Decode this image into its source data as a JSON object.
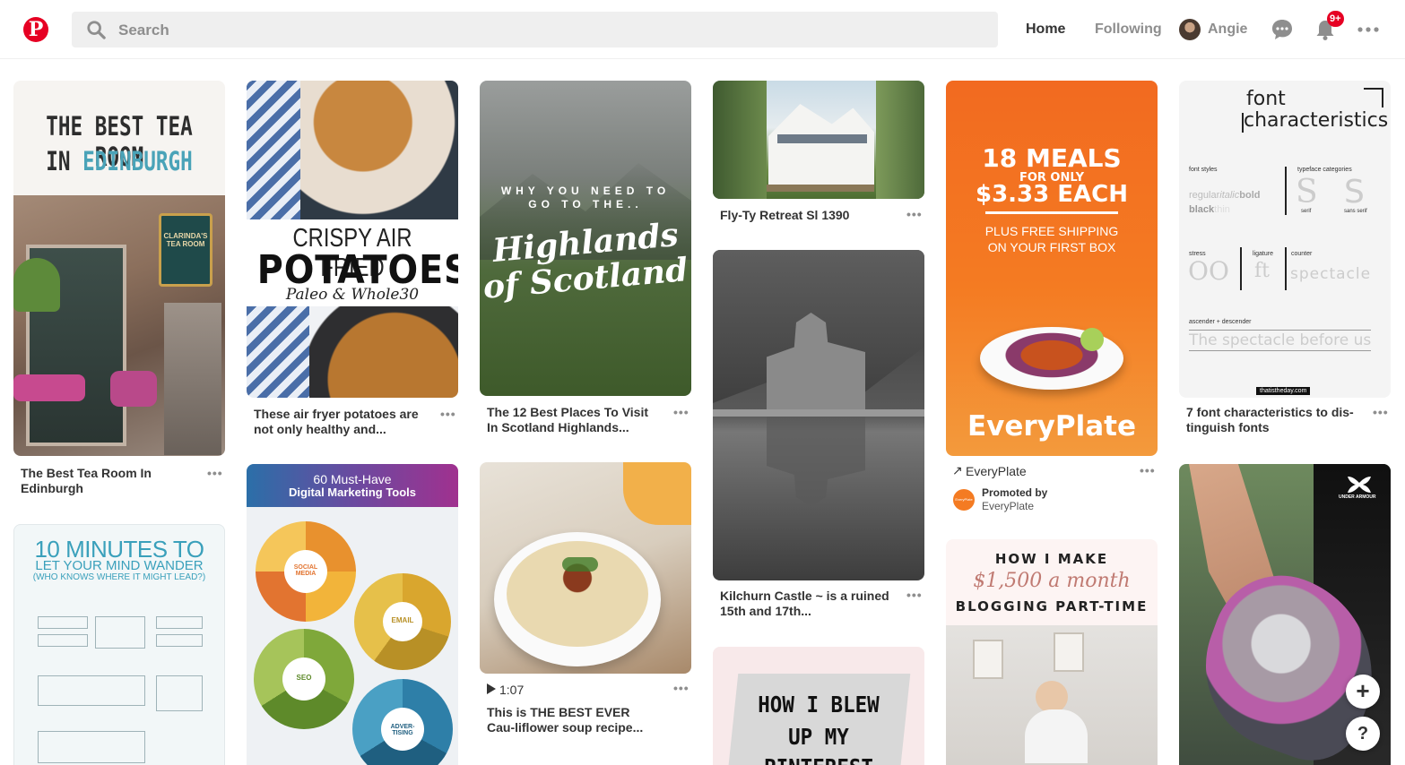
{
  "header": {
    "logo": "P",
    "search_placeholder": "Search",
    "nav_home": "Home",
    "nav_following": "Following",
    "user_name": "Angie",
    "notifications_badge": "9+",
    "accent_color": "#e60023"
  },
  "more_label": "•••",
  "pins": {
    "tea_room": {
      "title": "The Best Tea Room In Edinburgh",
      "image_line1": "THE BEST TEA ROOM",
      "image_line2_prefix": "IN",
      "image_line2_accent": "EDINBURGH",
      "sign_text": "CLARINDA'S TEA ROOM"
    },
    "potatoes": {
      "title": "These air fryer potatoes are not only healthy and...",
      "image_line1": "CRISPY AIR FRIED",
      "image_line2": "POTATOES",
      "image_line3": "Paleo & Whole30"
    },
    "highlands": {
      "title": "The 12 Best Places To Visit In Scotland Highlands...",
      "image_line1": "WHY YOU NEED TO",
      "image_line2": "GO TO THE..",
      "image_line3": "Highlands",
      "image_line4": "of Scotland"
    },
    "retreat": {
      "title": "Fly-Ty Retreat Sl 1390"
    },
    "everyplate": {
      "image_line1": "18 MEALS",
      "image_line2": "FOR ONLY",
      "image_line3": "$3.33 EACH",
      "image_line4": "PLUS FREE SHIPPING",
      "image_line5": "ON YOUR FIRST BOX",
      "image_brand": "EveryPlate",
      "link_label": "EveryPlate",
      "promoted_by": "Promoted by",
      "promoter": "EveryPlate",
      "promoter_logo_text": "EveryPlate"
    },
    "font": {
      "title": "7 font characteristics to dis-tinguish fonts",
      "image_line1": "font",
      "image_line2": "characteristics",
      "label_styles": "font styles",
      "styles_regular": "regular",
      "styles_italic": "italic",
      "styles_bold": "bold",
      "styles_black": "black",
      "styles_thin": "thin",
      "label_typeface": "typeface categories",
      "serif_label": "serif",
      "sans_label": "sans serif",
      "label_stress": "stress",
      "label_ligature": "ligature",
      "label_counter": "counter",
      "ligature_glyph": "ft",
      "counter_word": "spectacle",
      "label_ascender": "ascender + descender",
      "spectacle_sentence": "The spectacle before us",
      "site": "thatistheday.com"
    },
    "mind_wander": {
      "image_line1": "10 MINUTES TO",
      "image_line2": "LET YOUR MIND WANDER",
      "image_line3": "(WHO KNOWS WHERE IT MIGHT LEAD?)"
    },
    "marketing": {
      "image_line1": "60 Must-Have",
      "image_line2": "Digital Marketing Tools",
      "wheel1": "SOCIAL MEDIA",
      "wheel2": "EMAIL",
      "wheel3": "SEO",
      "wheel4": "ADVER-TISING"
    },
    "soup": {
      "duration": "1:07",
      "title": "This is THE BEST EVER Cau-liflower soup recipe..."
    },
    "castle": {
      "title": "Kilchurn Castle ~ is a ruined 15th and 17th..."
    },
    "blew": {
      "image_line1": "HOW I BLEW",
      "image_line2": "UP MY",
      "image_line3": "PINTEREST"
    },
    "blogging": {
      "image_line1": "HOW I MAKE",
      "image_line2": "$1,500 a month",
      "image_line3": "BLOGGING PART-TIME"
    },
    "shoe": {
      "brand": "UNDER ARMOUR"
    }
  },
  "fab": {
    "add": "+",
    "help": "?"
  }
}
